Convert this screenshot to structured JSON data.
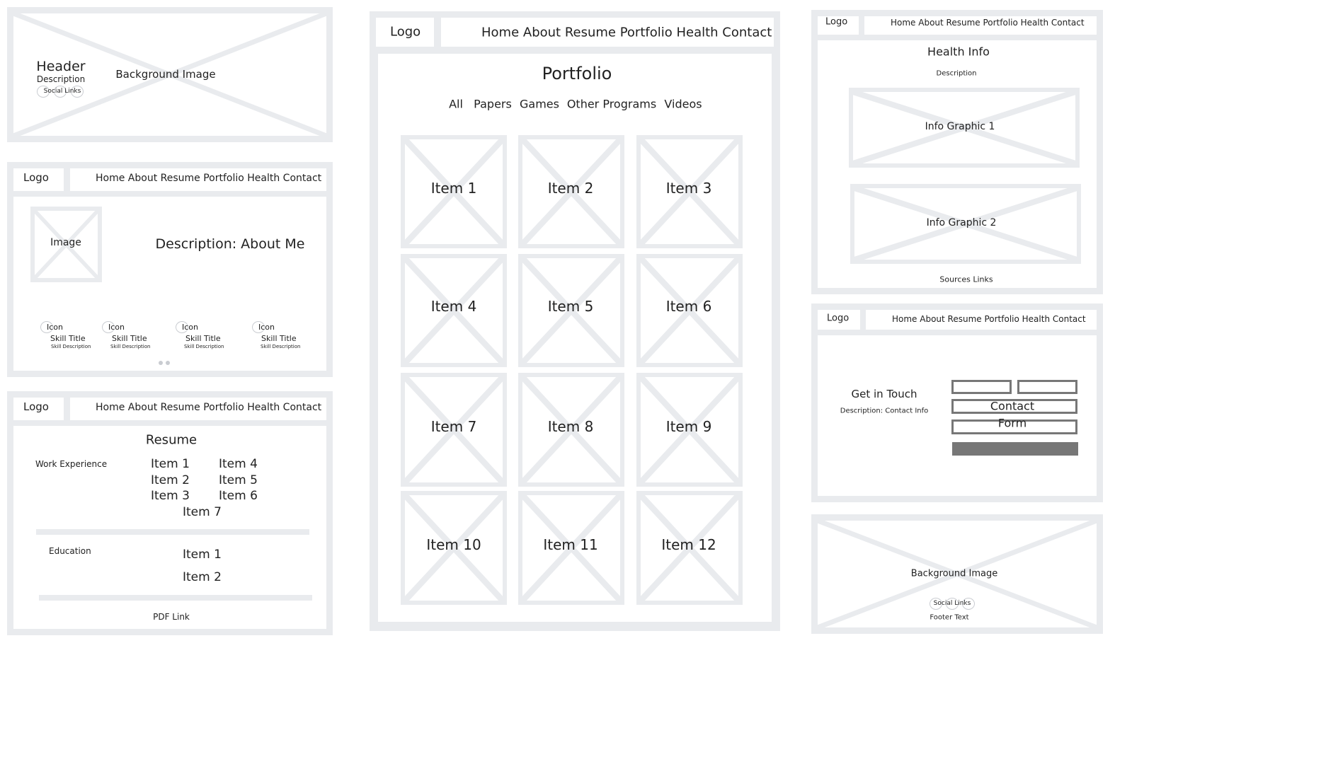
{
  "common": {
    "logo": "Logo",
    "nav": "Home About Resume Portfolio Health Contact"
  },
  "header_frame": {
    "title": "Header",
    "description": "Description",
    "social": "Social Links",
    "bg": "Background Image"
  },
  "about_frame": {
    "image": "Image",
    "description": "Description: About Me",
    "skills": [
      {
        "icon": "Icon",
        "title": "Skill Title",
        "desc": "Skill Description"
      },
      {
        "icon": "Icon",
        "title": "Skill Title",
        "desc": "Skill Description"
      },
      {
        "icon": "Icon",
        "title": "Skill Title",
        "desc": "Skill Description"
      },
      {
        "icon": "Icon",
        "title": "Skill Title",
        "desc": "Skill Description"
      }
    ]
  },
  "resume_frame": {
    "title": "Resume",
    "work_label": "Work Experience",
    "work_items": [
      "Item 1",
      "Item 2",
      "Item 3",
      "Item 4",
      "Item 5",
      "Item 6",
      "Item 7"
    ],
    "edu_label": "Education",
    "edu_items": [
      "Item 1",
      "Item 2"
    ],
    "pdf": "PDF Link"
  },
  "portfolio_frame": {
    "title": "Portfolio",
    "filters": [
      "All",
      "Papers",
      "Games",
      "Other Programs",
      "Videos"
    ],
    "items": [
      "Item 1",
      "Item 2",
      "Item 3",
      "Item 4",
      "Item 5",
      "Item 6",
      "Item 7",
      "Item 8",
      "Item 9",
      "Item 10",
      "Item 11",
      "Item 12"
    ]
  },
  "health_frame": {
    "title": "Health Info",
    "description": "Description",
    "graphic1": "Info Graphic 1",
    "graphic2": "Info Graphic 2",
    "sources": "Sources Links"
  },
  "contact_frame": {
    "title": "Get in Touch",
    "description": "Description: Contact Info",
    "form_line1": "Contact",
    "form_line2": "Form"
  },
  "footer_frame": {
    "bg": "Background Image",
    "social": "Social Links",
    "text": "Footer Text"
  }
}
